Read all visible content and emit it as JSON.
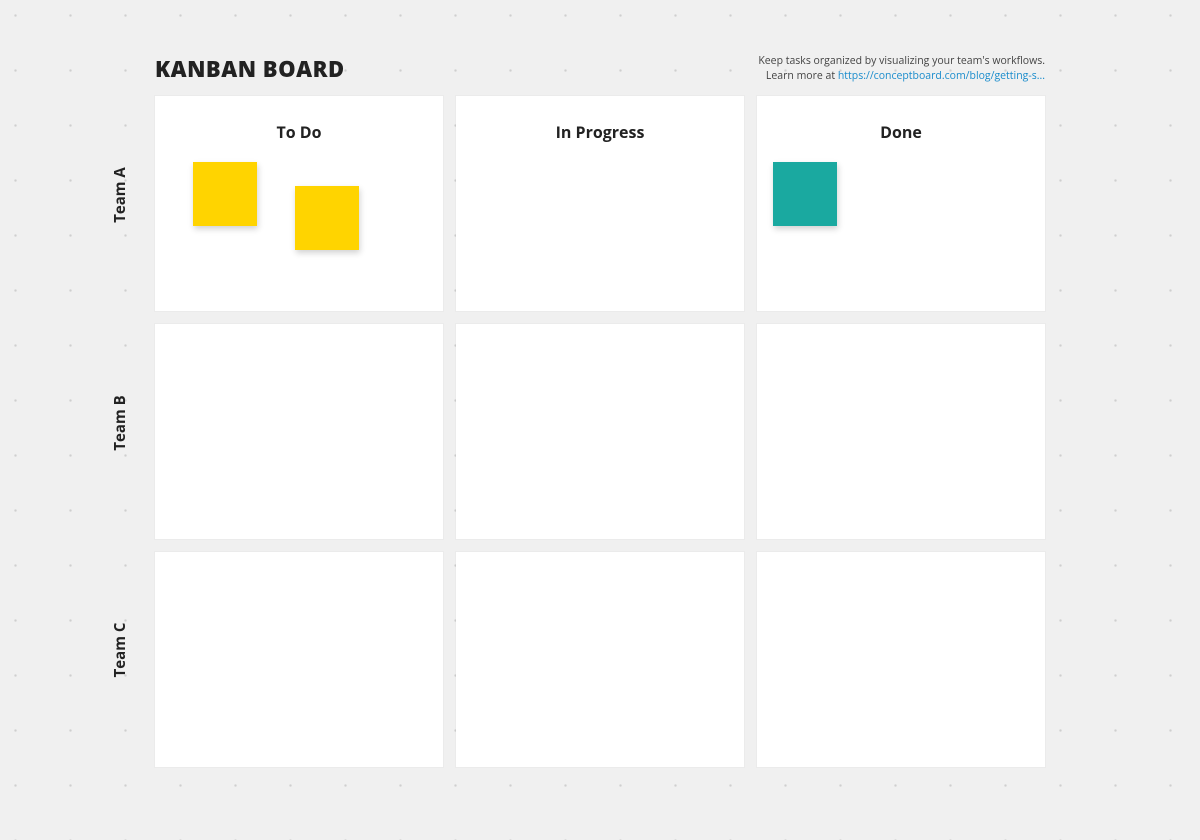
{
  "title": "KANBAN BOARD",
  "help": {
    "line1": "Keep tasks organized by visualizing your team's workflows.",
    "line2_prefix": "Learn more at ",
    "link_text": "https://conceptboard.com/blog/getting-s..."
  },
  "columns": [
    "To Do",
    "In Progress",
    "Done"
  ],
  "rows": [
    "Team A",
    "Team B",
    "Team C"
  ],
  "stickies": [
    {
      "row": 0,
      "col": 0,
      "color": "yellow",
      "pos": "sticky1"
    },
    {
      "row": 0,
      "col": 0,
      "color": "yellow",
      "pos": "sticky2"
    },
    {
      "row": 0,
      "col": 2,
      "color": "teal",
      "pos": "sticky3"
    }
  ]
}
